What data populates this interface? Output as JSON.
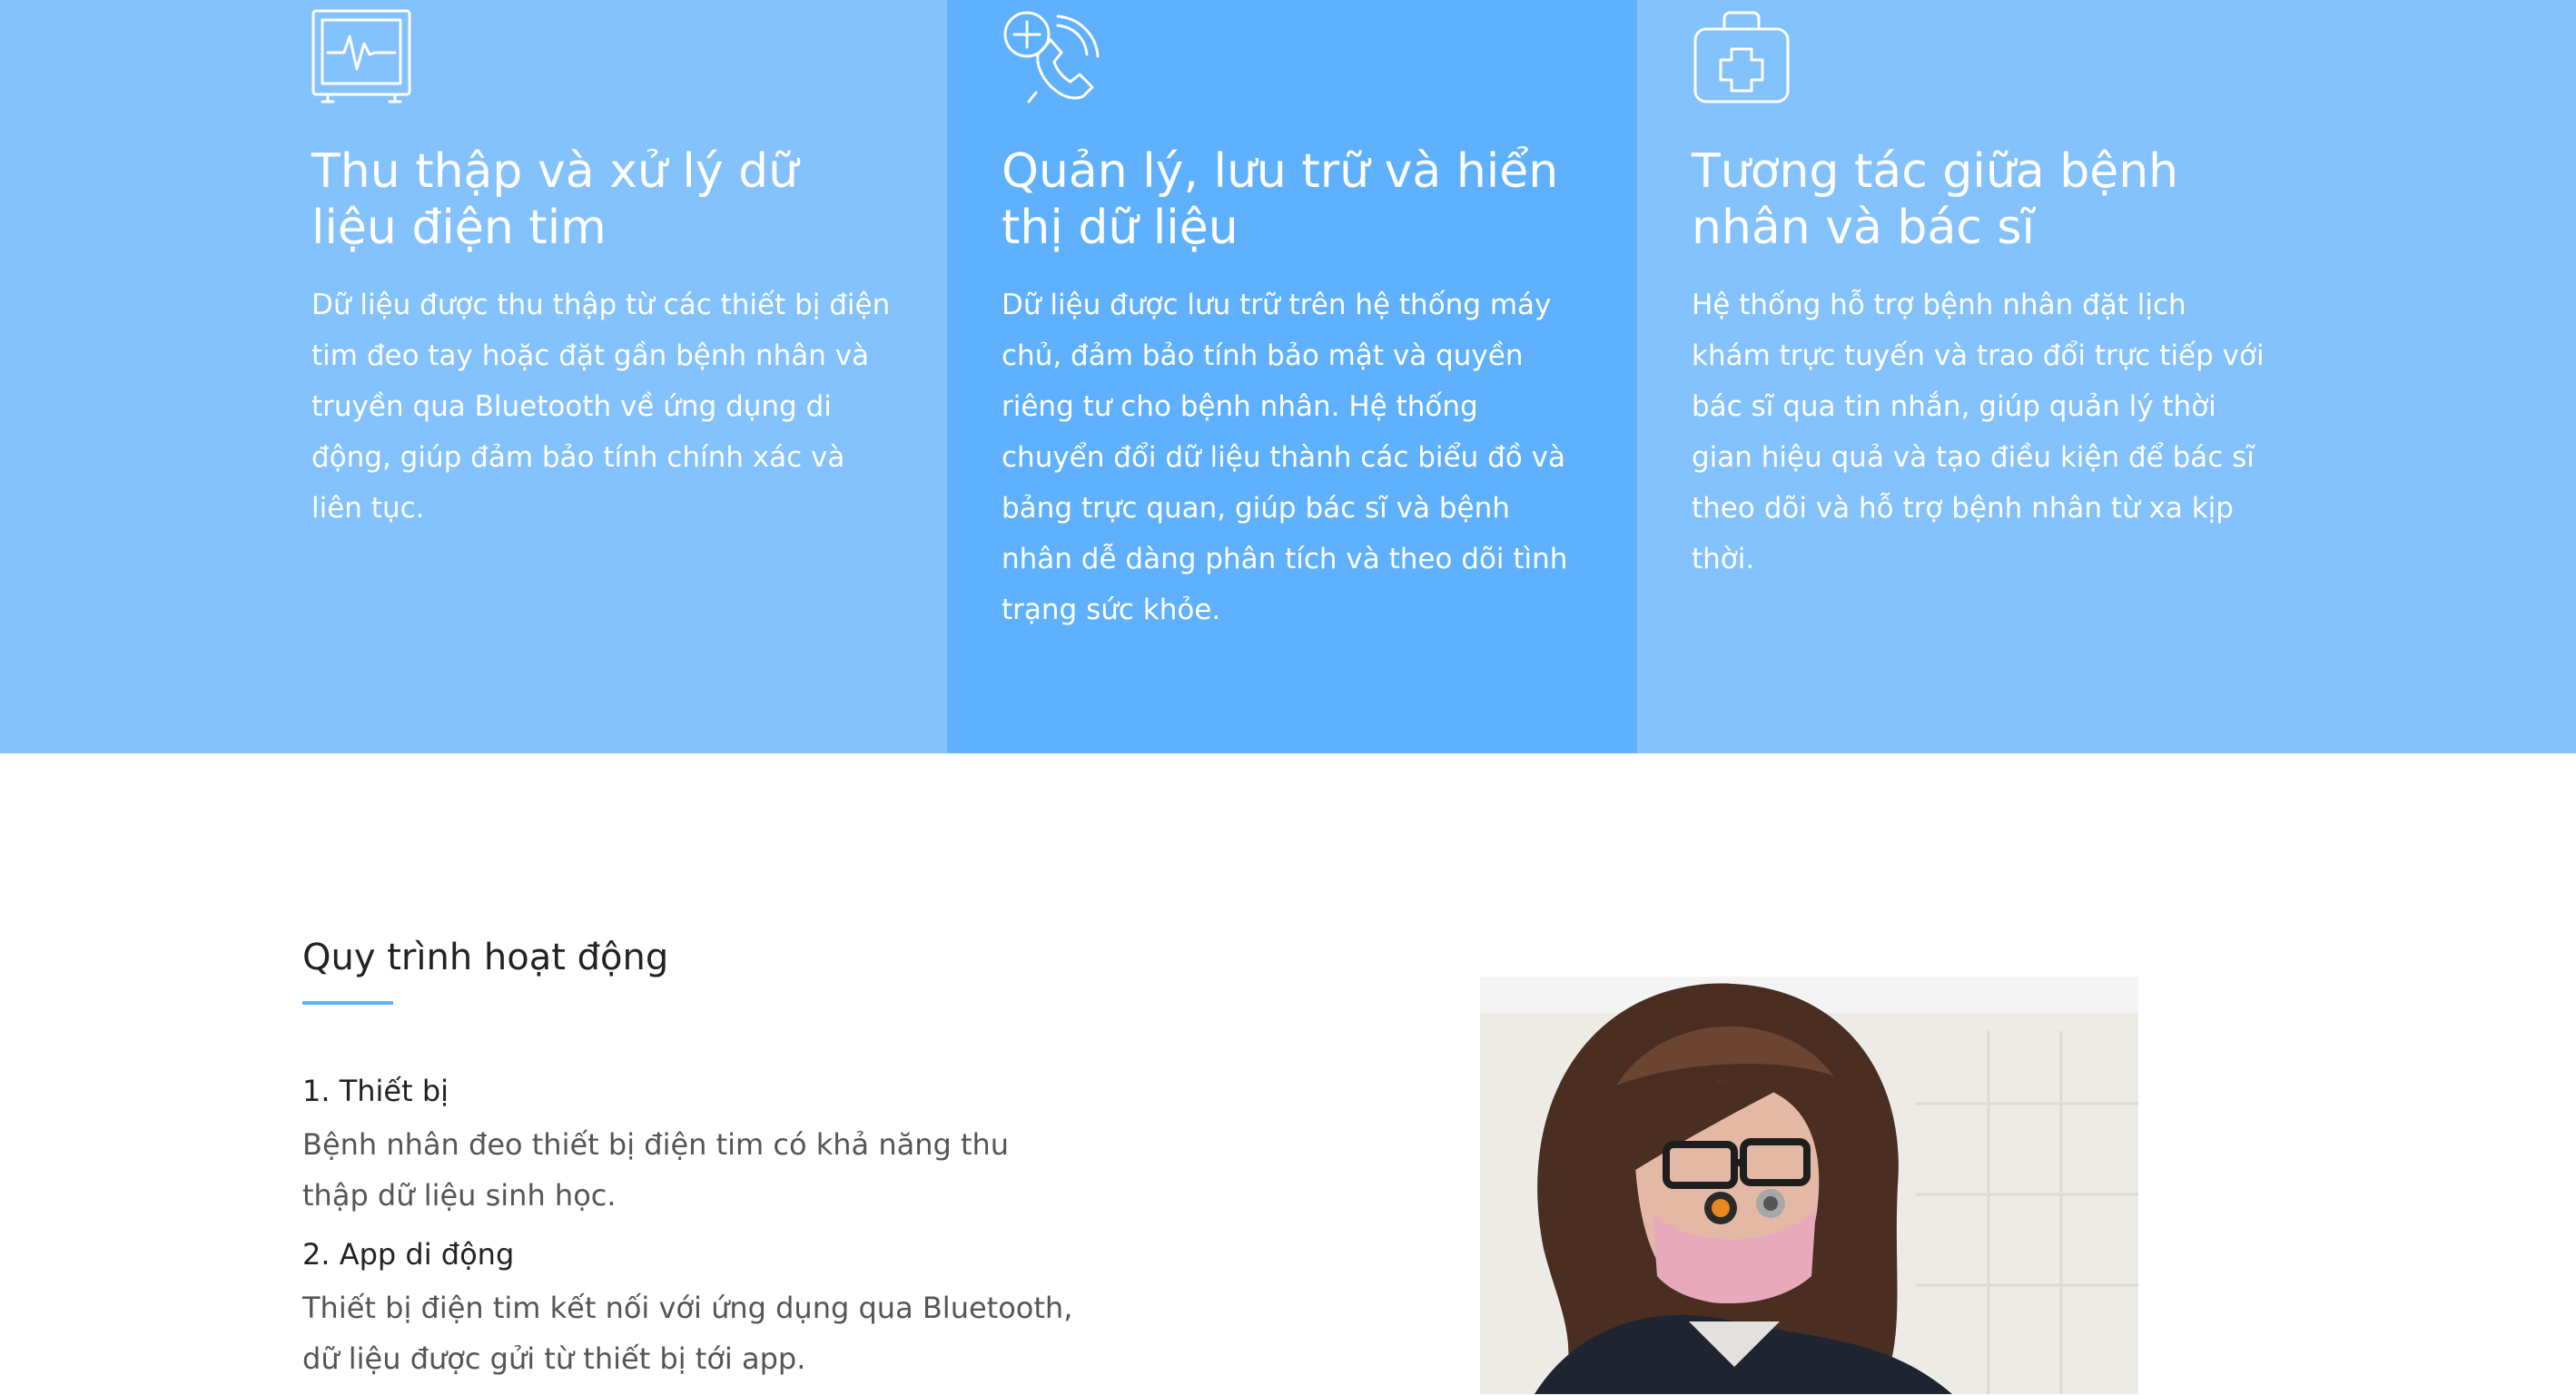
{
  "features": [
    {
      "icon": "heart-monitor-icon",
      "title": "Thu thập và xử lý dữ liệu điện tim",
      "text": "Dữ liệu được thu thập từ các thiết bị điện tim đeo tay hoặc đặt gần bệnh nhân và truyền qua Bluetooth về ứng dụng di động, giúp đảm bảo tính chính xác và liên tục."
    },
    {
      "icon": "medical-phone-icon",
      "title": "Quản lý, lưu trữ và hiển thị dữ liệu",
      "text": "Dữ liệu được lưu trữ trên hệ thống máy chủ, đảm bảo tính bảo mật và quyền riêng tư cho bệnh nhân. Hệ thống chuyển đổi dữ liệu thành các biểu đồ và bảng trực quan, giúp bác sĩ và bệnh nhân dễ dàng phân tích và theo dõi tình trạng sức khỏe."
    },
    {
      "icon": "first-aid-kit-icon",
      "title": "Tương tác giữa bệnh nhân và bác sĩ",
      "text": "Hệ thống hỗ trợ bệnh nhân đặt lịch khám trực tuyến và trao đổi trực tiếp với bác sĩ qua tin nhắn, giúp quản lý thời gian hiệu quả và tạo điều kiện để bác sĩ theo dõi và hỗ trợ bệnh nhân từ xa kịp thời."
    }
  ],
  "process": {
    "title": "Quy trình hoạt động",
    "steps": [
      {
        "title": "1. Thiết bị",
        "text": "Bệnh nhân đeo thiết bị điện tim có khả năng thu thập dữ liệu sinh học."
      },
      {
        "title": "2. App di động",
        "text": "Thiết bị điện tim kết nối với ứng dụng qua Bluetooth, dữ liệu được gửi từ thiết bị tới app."
      }
    ]
  },
  "colors": {
    "panel_light": "#84c2fd",
    "panel_mid": "#5fb1fd",
    "accent": "#5fb1fd"
  }
}
